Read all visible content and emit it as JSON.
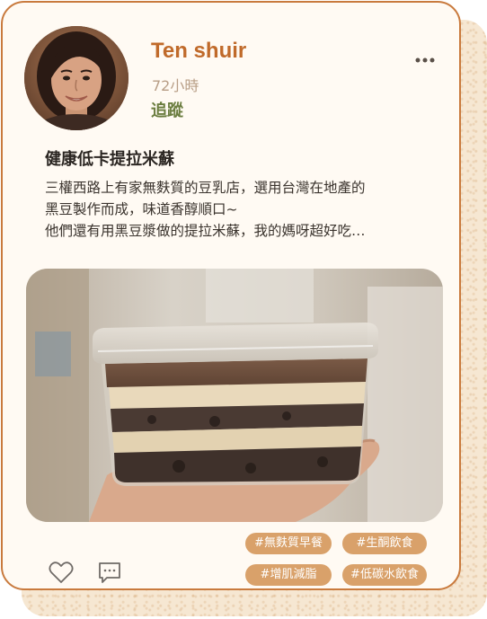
{
  "post": {
    "author_name": "Ten shuir",
    "time": "72小時",
    "follow_label": "追蹤",
    "title": "健康低卡提拉米蘇",
    "body_lines": [
      "三權西路上有家無麩質的豆乳店，選用台灣在地產的",
      "黑豆製作而成，味道香醇順口~",
      "他們還有用黑豆漿做的提拉米蘇，我的媽呀超好吃…"
    ],
    "tags": [
      "#無麩質早餐",
      "#生酮飲食",
      "#增肌減脂",
      "#低碳水飲食"
    ]
  },
  "icons": {
    "more": "more-dots-icon",
    "like": "heart-icon",
    "comment": "comment-icon"
  },
  "colors": {
    "accent": "#c97a3d",
    "name": "#c06a2a",
    "follow": "#6b7d3f",
    "tag_bg": "#d9a16a",
    "card_bg": "#fffaf3"
  }
}
